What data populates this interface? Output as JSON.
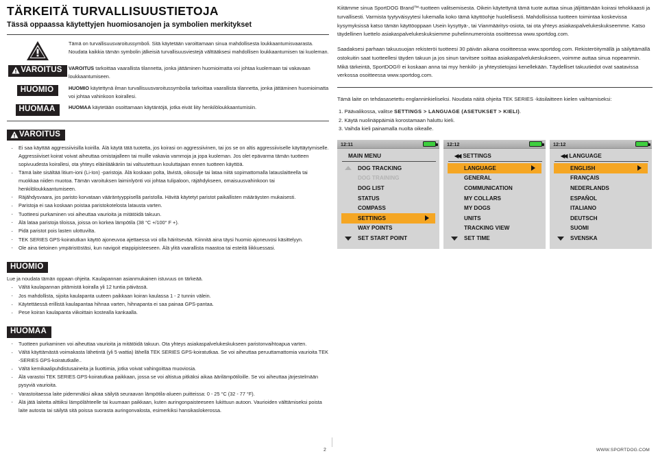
{
  "document": {
    "title": "TÄRKEITÄ TURVALLISUUSTIETOJA",
    "subtitle": "Tässä oppaassa käytettyjen huomiosanojen ja symbolien merkitykset",
    "page_number": "2",
    "footer_url": "WWW.SPORTDOG.COM"
  },
  "symbols": {
    "safety_alert": {
      "icon": "warning-triangle-icon",
      "text": "Tämä on turvallisuusvaroitussymboli. Sitä käytetään varoittamaan sinua mahdollisesta loukkaantumisvaarasta. Noudata kaikkia tämän symbolin jälkeisiä turvallisuusviestejä välttääksesi mahdollisen loukkaantumisen tai kuoleman."
    },
    "varoitus": {
      "badge": "VAROITUS",
      "lead": "VAROITUS",
      "text": " tarkoittaa vaarallista tilannetta, jonka jättäminen huomioimatta voi johtaa kuolemaan tai vakavaan loukkaantumiseen."
    },
    "huomio": {
      "badge": "HUOMIO",
      "lead": "HUOMIO",
      "text": " käytettynä ilman turvallisuusvaroitussymbolia tarkoittaa vaarallista tilannetta, jonka jättäminen huomioimatta voi johtaa vahinkoon koirallesi."
    },
    "huomaa": {
      "badge": "HUOMAA",
      "lead": "HUOMAA",
      "text": " käytetään osoittamaan käytäntöjä, jotka eivät liity henkilöloukkaantumisiin."
    }
  },
  "varoitus_section": {
    "badge": "VAROITUS",
    "items": [
      "Ei saa käyttää aggressiivisilla koirilla. Älä käytä tätä tuotetta, jos koirasi on aggressiivinen, tai jos se on altis aggressiiviselle käyttäytymiselle. Aggressiiviset koirat voivat aiheuttaa omistajalleen tai muille vakavia vammoja ja jopa kuoleman. Jos olet epävarma tämän tuotteen sopivuudesta koirallesi, ota yhteys eläinlääkäriin tai valtuutettuun kouluttajaan ennen tuotteen käyttöä.",
      "Tämä laite sisältää litium-ioni (Li-Ion) -paristoja. Älä koskaan polta, lävistä, oikosulje tai lataa niitä sopimattomalla latauslaitteella tai muokkaa niiden muotoa. Tämän varoituksen laiminlyönti voi johtaa tulipaloon, räjähdykseen, omaisuusvahinkoon tai henkilöloukkaantumiseen.",
      "Räjähdysvaara, jos paristo korvataan vääräntyyppisellä paristolla. Hävitä käytetyt paristot paikallisten määräysten mukaisesti.",
      "Paristoja ei saa koskaan poistaa paristokotelosta latausta varten.",
      "Tuotteesi purkaminen voi aiheuttaa vaurioita ja mitätöidä takuun.",
      "Älä lataa paristoja tiloissa, joissa on korkea lämpötila (38 °C +/100° F +).",
      "Pidä paristot pois lasten ulottuvilta.",
      "TEK SERIES GPS-koiratutkan käyttö ajoneuvoa ajettaessa voi olla häiritsevää. Kiinnitä aina täysi huomio ajoneuvosi käsittelyyn.",
      "Ole aina tietoinen ympäristöstäsi, kun navigoit etappipisteeseen. Älä ylitä vaarallista maastoa tai esteitä liikkuessasi."
    ]
  },
  "huomio_section": {
    "badge": "HUOMIO",
    "lead": "Lue ja noudata tämän oppaan ohjeita. Kaulapannan asianmukainen istuvuus on tärkeää.",
    "items": [
      "Vältä kaulapannan pitämistä koiralla yli 12 tuntia päivässä.",
      "Jos mahdollista, sijoita kaulapanta uuteen paikkaan koiran kaulassa 1 - 2 tunnin välein.",
      "Käytettäessä erillistä kaulapantaa hihnaa varten, hihnapanta ei saa painaa GPS-pantaa.",
      "Pese koiran kaulapanta viikoittain kostealla kankaalla."
    ]
  },
  "huomaa_section": {
    "badge": "HUOMAA",
    "items": [
      "Tuotteen purkaminen voi aiheuttaa vaurioita ja mitätöidä takuun. Ota yhteys asiakaspalvelukeskukseen paristonvaihtoapua varten.",
      "Vältä käyttämästä voimakasta lähetintä (yli 5 wattia) lähellä TEK SERIES GPS-koiratutkaa. Se voi aiheuttaa peruuttamattomia vaurioita TEK -SERIES GPS-koiratutkalle..",
      "Vältä kemikaalipuhdistusaineita ja liuottimia, jotka voivat vahingoittaa muoviosia.",
      "Älä varastoi TEK SERIES GPS-koiratutkaa paikkaan, jossa se voi altistua pitkäksi aikaa äärilämpötiloille. Se voi aiheuttaa järjestelmään pysyviä vaurioita.",
      "Varastoitaessa laite pidemmäksi aikaa säilytä seuraavan lämpötila-alueen puitteissa: 0 - 25 °C (32 - 77 °F).",
      "Älä jätä laitetta alttiiksi lämpölähteelle tai kuumaan paikkaan, kuten auringonpaisteeseen lukittuun autoon. Vaurioiden välttämiseksi poista laite autosta tai säilytä sitä poissa suorasta auringonvalosta, esimerkiksi hansikaslokerossa."
    ]
  },
  "intro": {
    "paragraph1": "Kiitämme sinua SportDOG Brand™-tuotteen valitsemisesta. Oikein käytettynä tämä tuote auttaa sinua jäljittämään koirasi tehokkaasti ja turvallisesti. Varmista tyytyväisyytesi lukemalla koko tämä käyttöohje huolellisesti. Mahdollisissa tuotteen toimintaa koskevissa kysymyksissä katso tämän käyttöoppaan Usein kysyttyä-, tai Vianmääritys-osiota, tai ota yhteys asiakaspalvelukeskukseemme. Katso täydellinen luettelo asiakaspalvelukeskuksiemme puhelinnumeroista osoitteessa www.sportdog.com.",
    "paragraph2": "Saadaksesi parhaan takuusuojan rekisteröi tuotteesi 30 päivän aikana osoitteessa www.sportdog.com. Rekisteröitymällä ja säilyttämällä ostokuitin saat tuotteellesi täyden takuun ja jos sinun tarvitsee soittaa asiakaspalvelukeskukseen, voimme auttaa sinua nopeammin. Mikä tärkeintä, SportDOG® ei koskaan anna tai myy henkilö- ja yhteystietojasi kenellekään. Täydelliset takuutiedot ovat saatavissa verkossa osoitteessa www.sportdog.com."
  },
  "language_instructions": {
    "intro": "Tämä laite on tehdasasetettu englanninkieliseksi. Noudata näitä ohjeita TEK SERIES -käsilaitteen kielen vaihtamiseksi:",
    "step1_prefix": "1. Päävalikossa, valitse ",
    "step1_bold": "SETTINGS > LANGUAGE (ASETUKSET > KIELI)",
    "step1_suffix": ".",
    "step2": "2. Käytä nuolinäppäimiä korostamaan haluttu kieli.",
    "step3": "3. Vaihda kieli painamalla nuolta oikealle."
  },
  "screens": [
    {
      "time": "12:11",
      "battery_icon": "battery-full-icon",
      "title": "MAIN MENU",
      "has_back_arrows": false,
      "scroll_up": true,
      "scroll_down": true,
      "items": [
        {
          "label": "DOG TRACKING",
          "state": "normal"
        },
        {
          "label": "DOG TRAINING",
          "state": "disabled"
        },
        {
          "label": "DOG LIST",
          "state": "normal"
        },
        {
          "label": "STATUS",
          "state": "normal"
        },
        {
          "label": "COMPASS",
          "state": "normal"
        },
        {
          "label": "SETTINGS",
          "state": "selected"
        },
        {
          "label": "WAY POINTS",
          "state": "normal"
        },
        {
          "label": "SET START POINT",
          "state": "normal"
        }
      ]
    },
    {
      "time": "12:12",
      "battery_icon": "battery-full-icon",
      "title": "SETTINGS",
      "has_back_arrows": true,
      "scroll_up": true,
      "scroll_down": true,
      "items": [
        {
          "label": "LANGUAGE",
          "state": "selected"
        },
        {
          "label": "GENERAL",
          "state": "normal"
        },
        {
          "label": "COMMUNICATION",
          "state": "normal"
        },
        {
          "label": "MY COLLARS",
          "state": "normal"
        },
        {
          "label": "MY DOGS",
          "state": "normal"
        },
        {
          "label": "UNITS",
          "state": "normal"
        },
        {
          "label": "TRACKING VIEW",
          "state": "normal"
        },
        {
          "label": "SET TIME",
          "state": "normal"
        }
      ]
    },
    {
      "time": "12:12",
      "battery_icon": "battery-full-icon",
      "title": "LANGUAGE",
      "has_back_arrows": true,
      "scroll_up": true,
      "scroll_down": true,
      "items": [
        {
          "label": "ENGLISH",
          "state": "selected"
        },
        {
          "label": "FRANÇAIS",
          "state": "normal"
        },
        {
          "label": "NEDERLANDS",
          "state": "normal"
        },
        {
          "label": "ESPAÑOL",
          "state": "normal"
        },
        {
          "label": "ITALIANO",
          "state": "normal"
        },
        {
          "label": "DEUTSCH",
          "state": "normal"
        },
        {
          "label": "SUOMI",
          "state": "normal"
        },
        {
          "label": "SVENSKA",
          "state": "normal"
        }
      ]
    }
  ],
  "colors": {
    "badge_bg": "#231f20",
    "selection": "#f5a623",
    "screen_bg": "#d4d4d4",
    "battery": "#3fcf3f"
  }
}
